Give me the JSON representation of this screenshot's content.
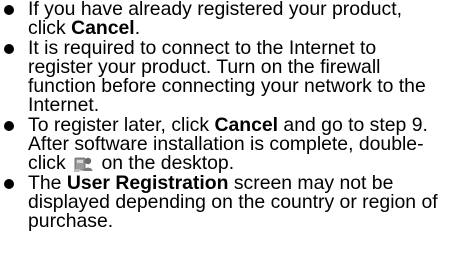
{
  "notes": [
    {
      "lines": [
        [
          {
            "t": "If you have already registered your product,"
          }
        ],
        [
          {
            "t": "click "
          },
          {
            "t": "Cancel",
            "b": true
          },
          {
            "t": "."
          }
        ]
      ]
    },
    {
      "lines": [
        [
          {
            "t": "It is required to connect to the Internet to"
          }
        ],
        [
          {
            "t": "register your product. Turn on the firewall"
          }
        ],
        [
          {
            "t": "function before connecting your network to the"
          }
        ],
        [
          {
            "t": "Internet."
          }
        ]
      ]
    },
    {
      "lines": [
        [
          {
            "t": "To register later, click "
          },
          {
            "t": "Cancel",
            "b": true
          },
          {
            "t": " and go to step 9."
          }
        ],
        [
          {
            "t": "After software installation is complete, double-"
          }
        ],
        [
          {
            "t": "click "
          },
          {
            "icon": "user-registration-shortcut-icon"
          },
          {
            "t": " on the desktop."
          }
        ]
      ]
    },
    {
      "lines": [
        [
          {
            "t": "The "
          },
          {
            "t": "User Registration",
            "b": true
          },
          {
            "t": " screen may not be"
          }
        ],
        [
          {
            "t": "displayed depending on the country or region of"
          }
        ],
        [
          {
            "t": "purchase."
          }
        ]
      ]
    }
  ],
  "icons": {
    "bullet": "filled-circle-bullet",
    "shortcut": "user-registration-shortcut-icon"
  },
  "colors": {
    "text": "#000000",
    "background": "#ffffff"
  }
}
